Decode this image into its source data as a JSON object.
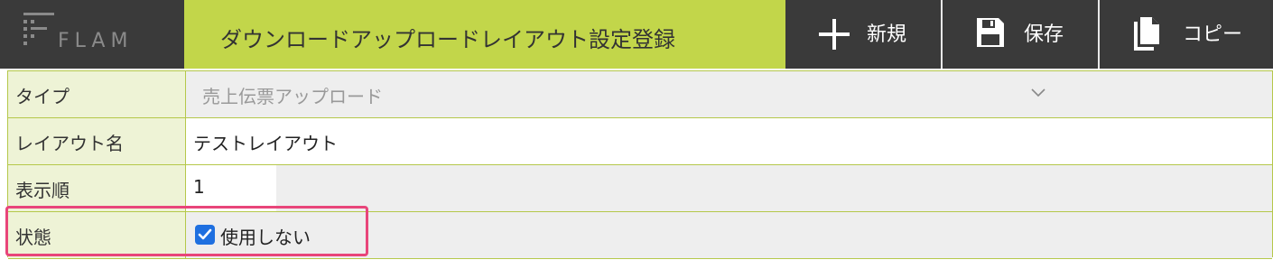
{
  "header": {
    "logo_text": "FLAM",
    "title": "ダウンロードアップロードレイアウト設定登録",
    "buttons": [
      {
        "label": "新規",
        "icon": "plus-icon"
      },
      {
        "label": "保存",
        "icon": "save-icon"
      },
      {
        "label": "コピー",
        "icon": "copy-icon"
      }
    ]
  },
  "form": {
    "type": {
      "label": "タイプ",
      "value": "売上伝票アップロード"
    },
    "layout_name": {
      "label": "レイアウト名",
      "value": "テストレイアウト"
    },
    "display_order": {
      "label": "表示順",
      "value": "1"
    },
    "status": {
      "label": "状態",
      "checkbox_label": "使用しない",
      "checked": true
    }
  },
  "colors": {
    "accent": "#c2d64a",
    "header_bg": "#3a3a3a",
    "highlight": "#e8457a",
    "checkbox": "#1f6fe0"
  }
}
